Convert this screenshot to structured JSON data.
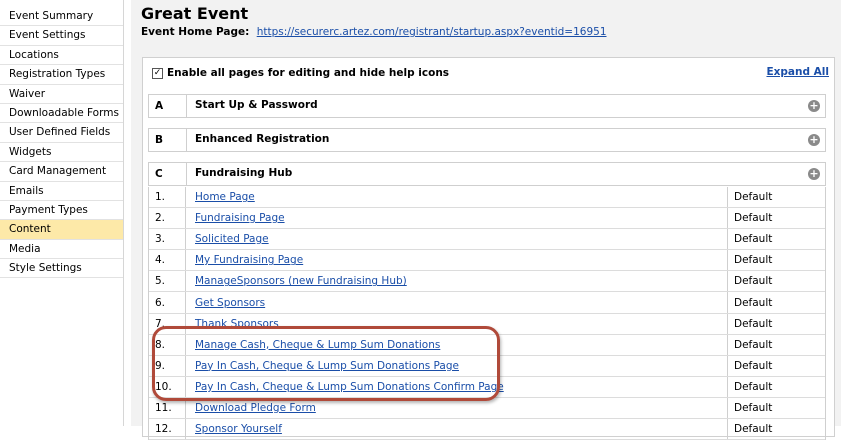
{
  "sidebar": {
    "items": [
      {
        "label": "Event Summary",
        "active": false
      },
      {
        "label": "Event Settings",
        "active": false
      },
      {
        "label": "Locations",
        "active": false
      },
      {
        "label": "Registration Types",
        "active": false
      },
      {
        "label": "Waiver",
        "active": false
      },
      {
        "label": "Downloadable Forms",
        "active": false
      },
      {
        "label": "User Defined Fields",
        "active": false
      },
      {
        "label": "Widgets",
        "active": false
      },
      {
        "label": "Card Management",
        "active": false
      },
      {
        "label": "Emails",
        "active": false
      },
      {
        "label": "Payment Types",
        "active": false
      },
      {
        "label": "Content",
        "active": true
      },
      {
        "label": "Media",
        "active": false
      },
      {
        "label": "Style Settings",
        "active": false
      }
    ]
  },
  "header": {
    "title": "Great Event",
    "home_label": "Event Home Page:",
    "home_url": "https://securerc.artez.com/registrant/startup.aspx?eventid=16951"
  },
  "panel": {
    "enable_label": "Enable all pages for editing and hide help icons",
    "enable_checked": "✓",
    "expand_all": "Expand All",
    "sections": [
      {
        "letter": "A",
        "title": "Start Up & Password"
      },
      {
        "letter": "B",
        "title": "Enhanced Registration"
      },
      {
        "letter": "C",
        "title": "Fundraising Hub"
      }
    ],
    "plus_icon": "+",
    "rows": [
      {
        "num": "1.",
        "name": "Home Page",
        "value": "Default"
      },
      {
        "num": "2.",
        "name": "Fundraising Page",
        "value": "Default"
      },
      {
        "num": "3.",
        "name": "Solicited Page",
        "value": "Default"
      },
      {
        "num": "4.",
        "name": "My Fundraising Page",
        "value": "Default"
      },
      {
        "num": "5.",
        "name": "ManageSponsors (new Fundraising Hub)",
        "value": "Default"
      },
      {
        "num": "6.",
        "name": "Get Sponsors",
        "value": "Default"
      },
      {
        "num": "7.",
        "name": "Thank Sponsors",
        "value": "Default"
      },
      {
        "num": "8.",
        "name": "Manage Cash, Cheque & Lump Sum Donations",
        "value": "Default"
      },
      {
        "num": "9.",
        "name": "Pay In Cash, Cheque & Lump Sum Donations Page",
        "value": "Default"
      },
      {
        "num": "10.",
        "name": "Pay In Cash, Cheque & Lump Sum Donations Confirm Page",
        "value": "Default"
      },
      {
        "num": "11.",
        "name": "Download Pledge Form",
        "value": "Default"
      },
      {
        "num": "12.",
        "name": "Sponsor Yourself",
        "value": "Default"
      }
    ]
  },
  "colors": {
    "link": "#1a4ea8",
    "active_sidebar": "#fde9a8",
    "highlight_border": "#b04a3a"
  }
}
